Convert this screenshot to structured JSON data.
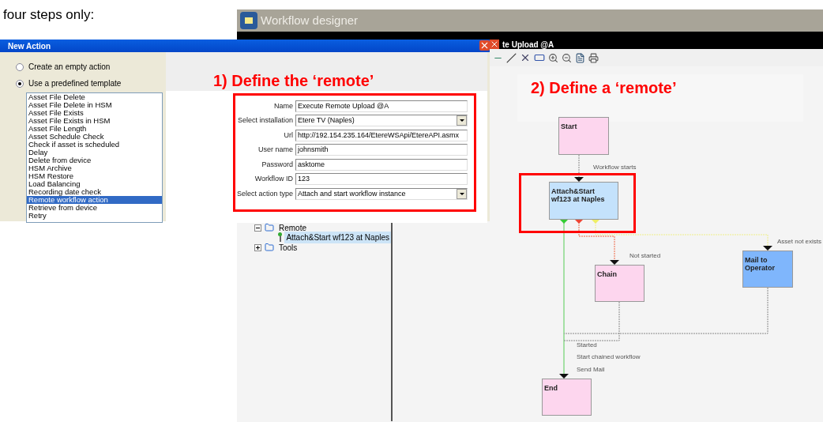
{
  "intro_text": "four steps only:",
  "new_action_dialog": {
    "title": "New Action",
    "options": [
      {
        "label": "Create an empty action",
        "selected": false
      },
      {
        "label": "Use a predefined template",
        "selected": true
      }
    ],
    "templates": [
      {
        "label": "Asset File Delete",
        "selected": false
      },
      {
        "label": "Asset File Delete in HSM",
        "selected": false
      },
      {
        "label": "Asset File Exists",
        "selected": false
      },
      {
        "label": "Asset File Exists in HSM",
        "selected": false
      },
      {
        "label": "Asset File Length",
        "selected": false
      },
      {
        "label": "Asset Schedule Check",
        "selected": false
      },
      {
        "label": "Check if asset is scheduled",
        "selected": false
      },
      {
        "label": "Delay",
        "selected": false
      },
      {
        "label": "Delete from device",
        "selected": false
      },
      {
        "label": "HSM Archive",
        "selected": false
      },
      {
        "label": "HSM Restore",
        "selected": false
      },
      {
        "label": "Load Balancing",
        "selected": false
      },
      {
        "label": "Recording date check",
        "selected": false
      },
      {
        "label": "Remote workflow action",
        "selected": true
      },
      {
        "label": "Retrieve from device",
        "selected": false
      },
      {
        "label": "Retry",
        "selected": false
      }
    ],
    "callout": "1) Define the ‘remote’",
    "form": [
      {
        "kind": "text",
        "label": "Name",
        "value": "Execute Remote Upload @A"
      },
      {
        "kind": "select",
        "label": "Select installation",
        "value": "Etere TV (Naples)"
      },
      {
        "kind": "text",
        "label": "Url",
        "value": "http://192.154.235.164/EtereWSApi/EtereAPI.asmx"
      },
      {
        "kind": "text",
        "label": "User name",
        "value": "johnsmith"
      },
      {
        "kind": "text",
        "label": "Password",
        "value": "asktome"
      },
      {
        "kind": "text",
        "label": "Workflow ID",
        "value": "123"
      },
      {
        "kind": "select",
        "label": "Select action type",
        "value": "Attach and start workflow instance"
      }
    ]
  },
  "workflow_designer": {
    "title": "Workflow designer",
    "document_title": "te Upload @A",
    "tree": [
      {
        "label": "Remote",
        "expanded": true,
        "children": [
          {
            "label": "Attach&Start wf123 at Naples",
            "selected": true
          }
        ]
      },
      {
        "label": "Tools",
        "expanded": false
      }
    ],
    "callout": "2) Define a ‘remote’",
    "nodes": [
      {
        "label": "Start",
        "color": "#fdd6ee"
      },
      {
        "label": "Attach&Start wf123 at Naples",
        "color": "#c4e2fc"
      },
      {
        "label": "Chain",
        "color": "#fdd6ee"
      },
      {
        "label": "Mail to Operator",
        "color": "#7fb6fc"
      },
      {
        "label": "End",
        "color": "#fdd6ee"
      }
    ],
    "connection_labels": [
      "Workflow starts",
      "Asset not exists",
      "Not started",
      "Started",
      "Start chained workflow",
      "Send Mail"
    ]
  }
}
